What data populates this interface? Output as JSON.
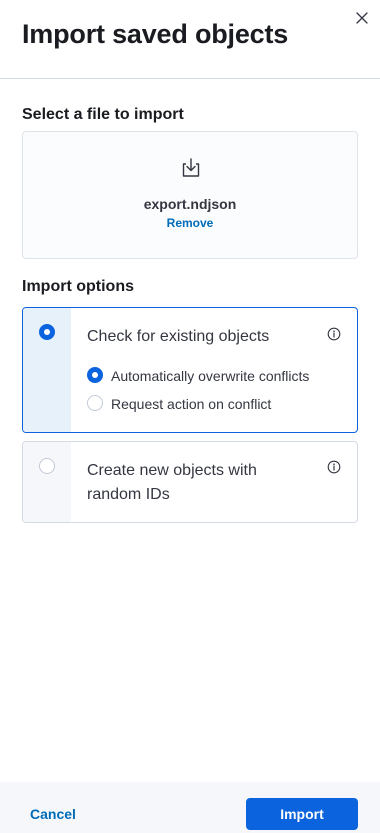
{
  "flyout": {
    "title": "Import saved objects",
    "close_icon": "close-icon"
  },
  "file_section": {
    "title": "Select a file to import",
    "icon": "import-icon",
    "file_name": "export.ndjson",
    "remove_label": "Remove"
  },
  "options_section": {
    "title": "Import options",
    "check_existing": {
      "label": "Check for existing objects",
      "selected": true,
      "info_icon": "info-icon",
      "sub_options": [
        {
          "label": "Automatically overwrite conflicts",
          "selected": true
        },
        {
          "label": "Request action on conflict",
          "selected": false
        }
      ]
    },
    "create_new": {
      "label_line1": "Create new objects with",
      "label_line2": "random IDs",
      "selected": false,
      "info_icon": "info-icon"
    }
  },
  "footer": {
    "cancel_label": "Cancel",
    "import_label": "Import"
  },
  "colors": {
    "primary": "#0b64dd",
    "link": "#006bb8",
    "selected_bg": "#e6f1fa",
    "footer_bg": "#f5f7fa"
  }
}
